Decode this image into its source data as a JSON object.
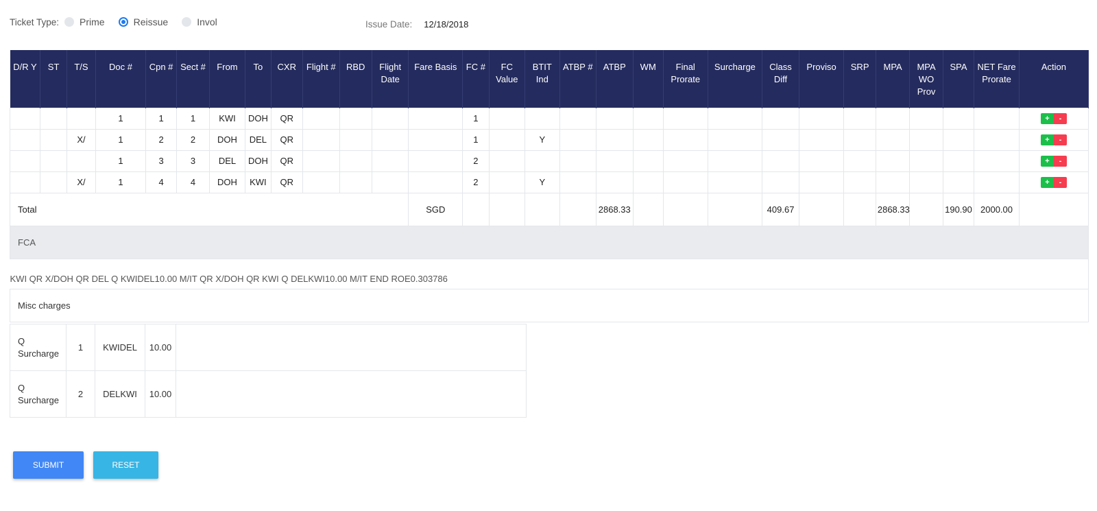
{
  "ticket_type": {
    "label": "Ticket Type:",
    "options": [
      {
        "label": "Prime",
        "checked": false
      },
      {
        "label": "Reissue",
        "checked": true
      },
      {
        "label": "Invol",
        "checked": false
      }
    ]
  },
  "issue_date": {
    "label": "Issue Date:",
    "value": "12/18/2018"
  },
  "table": {
    "headers": {
      "dry": "D/R Y",
      "st": "ST",
      "ts": "T/S",
      "doc": "Doc #",
      "cpn": "Cpn #",
      "sect": "Sect #",
      "from": "From",
      "to": "To",
      "cxr": "CXR",
      "flight": "Flight #",
      "rbd": "RBD",
      "flight_date": "Flight Date",
      "fare_basis": "Fare Basis",
      "fc": "FC #",
      "fc_value": "FC Value",
      "btit": "BTIT Ind",
      "atbp_no": "ATBP #",
      "atbp": "ATBP",
      "wm": "WM",
      "final_prorate": "Final Prorate",
      "surcharge": "Surcharge",
      "class_diff": "Class Diff",
      "proviso": "Proviso",
      "srp": "SRP",
      "mpa": "MPA",
      "mpa_wo_prov": "MPA WO Prov",
      "spa": "SPA",
      "net_fare_prorate": "NET Fare Prorate",
      "action": "Action"
    },
    "rows": [
      {
        "ts": "",
        "doc": "1",
        "cpn": "1",
        "sect": "1",
        "from": "KWI",
        "to": "DOH",
        "cxr": "QR",
        "fc": "1",
        "btit": ""
      },
      {
        "ts": "X/",
        "doc": "1",
        "cpn": "2",
        "sect": "2",
        "from": "DOH",
        "to": "DEL",
        "cxr": "QR",
        "fc": "1",
        "btit": "Y"
      },
      {
        "ts": "",
        "doc": "1",
        "cpn": "3",
        "sect": "3",
        "from": "DEL",
        "to": "DOH",
        "cxr": "QR",
        "fc": "2",
        "btit": ""
      },
      {
        "ts": "X/",
        "doc": "1",
        "cpn": "4",
        "sect": "4",
        "from": "DOH",
        "to": "KWI",
        "cxr": "QR",
        "fc": "2",
        "btit": "Y"
      }
    ],
    "action_plus": "+",
    "action_minus": "-",
    "total": {
      "label": "Total",
      "currency": "SGD",
      "atbp": "2868.33",
      "class_diff": "409.67",
      "mpa": "2868.33",
      "spa": "190.90",
      "net_fare_prorate": "2000.00"
    },
    "fca_label": "FCA",
    "fca_text": "KWI QR X/DOH QR DEL Q KWIDEL10.00 M/IT QR X/DOH QR KWI Q DELKWI10.00 M/IT END ROE0.303786",
    "misc_label": "Misc charges"
  },
  "misc_charges": [
    {
      "type": "Q Surcharge",
      "no": "1",
      "route": "KWIDEL",
      "amount": "10.00"
    },
    {
      "type": "Q Surcharge",
      "no": "2",
      "route": "DELKWI",
      "amount": "10.00"
    }
  ],
  "buttons": {
    "submit": "SUBMIT",
    "reset": "RESET"
  }
}
